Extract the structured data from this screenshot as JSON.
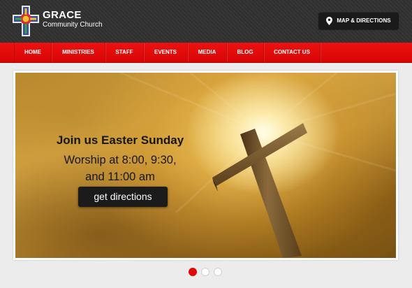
{
  "header": {
    "brand_name": "GRACE",
    "brand_subtitle": "Community Church",
    "map_button_label": "MAP & DIRECTIONS"
  },
  "nav": {
    "items": [
      "HOME",
      "MINISTRIES",
      "STAFF",
      "EVENTS",
      "MEDIA",
      "BLOG",
      "CONTACT US"
    ]
  },
  "hero": {
    "headline": "Join us Easter Sunday",
    "line1": "Worship at 8:00, 9:30,",
    "line2": "and 11:00 am",
    "cta_label": "get directions"
  },
  "slider": {
    "slides": 3,
    "active_index": 0
  },
  "icons": [
    "church-cross-logo-icon",
    "map-pin-icon"
  ],
  "colors": {
    "header_bg": "#2f2f2f",
    "nav_red": "#e30b0b",
    "dot_active": "#e10a0a",
    "button_dark": "#1b1b1b"
  }
}
